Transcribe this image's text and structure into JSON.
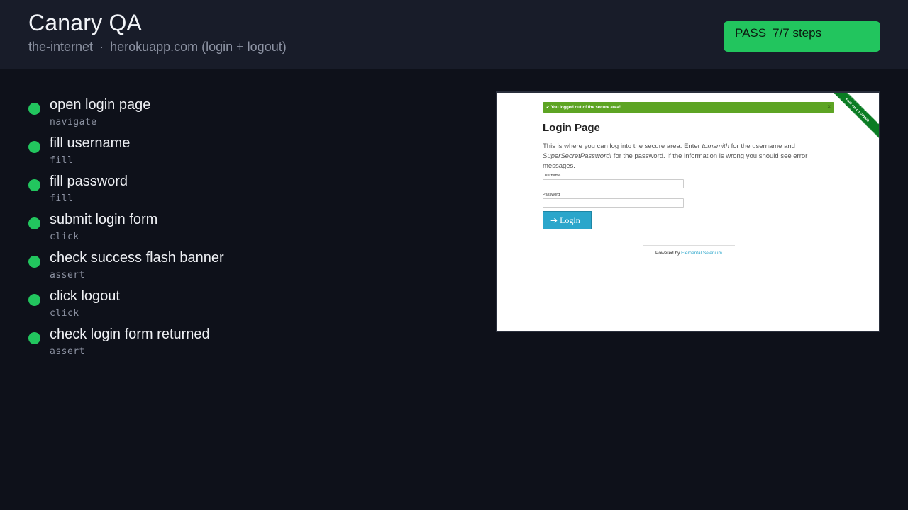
{
  "header": {
    "title": "Canary QA",
    "subtitle_site": "the-internet",
    "subtitle_separator": "·",
    "subtitle_target": "herokuapp.com (login + logout)"
  },
  "status": {
    "result": "PASS",
    "steps_text": "7/7 steps",
    "color": "#22c55e"
  },
  "steps": [
    {
      "title": "open login page",
      "kind": "navigate",
      "status": "pass"
    },
    {
      "title": "fill username",
      "kind": "fill",
      "status": "pass"
    },
    {
      "title": "fill password",
      "kind": "fill",
      "status": "pass"
    },
    {
      "title": "submit login form",
      "kind": "click",
      "status": "pass"
    },
    {
      "title": "check success flash banner",
      "kind": "assert",
      "status": "pass"
    },
    {
      "title": "click logout",
      "kind": "click",
      "status": "pass"
    },
    {
      "title": "check login form returned",
      "kind": "assert",
      "status": "pass"
    }
  ],
  "screenshot": {
    "flash_text": "You logged out of the secure area!",
    "flash_close": "×",
    "ribbon_text": "Fork me on GitHub",
    "heading": "Login Page",
    "intro_1": "This is where you can log into the secure area. Enter ",
    "intro_user": "tomsmith",
    "intro_2": " for the username and ",
    "intro_pass": "SuperSecretPassword!",
    "intro_3": " for the password. If the information is wrong you should see error messages.",
    "username_label": "Username",
    "password_label": "Password",
    "login_label": "Login",
    "footer_prefix": "Powered by ",
    "footer_link": "Elemental Selenium"
  }
}
